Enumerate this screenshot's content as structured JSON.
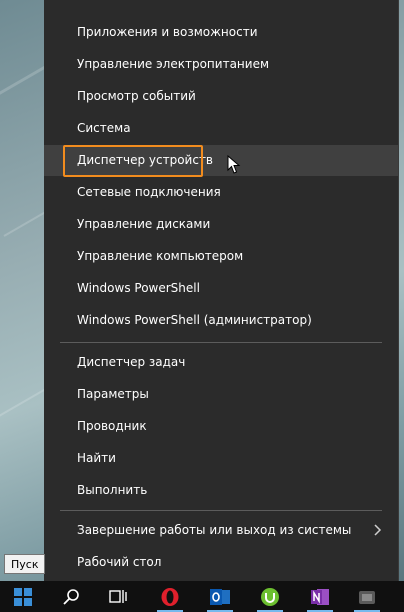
{
  "menu": {
    "items": [
      {
        "label": "Приложения и возможности"
      },
      {
        "label": "Управление электропитанием"
      },
      {
        "label": "Просмотр событий"
      },
      {
        "label": "Система"
      },
      {
        "label": "Диспетчер устройств"
      },
      {
        "label": "Сетевые подключения"
      },
      {
        "label": "Управление дисками"
      },
      {
        "label": "Управление компьютером"
      },
      {
        "label": "Windows PowerShell"
      },
      {
        "label": "Windows PowerShell (администратор)"
      },
      {
        "label": "Диспетчер задач"
      },
      {
        "label": "Параметры"
      },
      {
        "label": "Проводник"
      },
      {
        "label": "Найти"
      },
      {
        "label": "Выполнить"
      },
      {
        "label": "Завершение работы или выход из системы"
      },
      {
        "label": "Рабочий стол"
      }
    ]
  },
  "tooltip": {
    "text": "Пуск"
  },
  "taskbar": {
    "icons": [
      "windows-start-icon",
      "search-icon",
      "task-view-icon",
      "opera-icon",
      "outlook-icon",
      "utorrent-icon",
      "onenote-icon",
      "app-icon"
    ]
  },
  "colors": {
    "highlight": "#f28c1e",
    "menu_bg": "#2b2b2b",
    "hover_bg": "#404040"
  }
}
